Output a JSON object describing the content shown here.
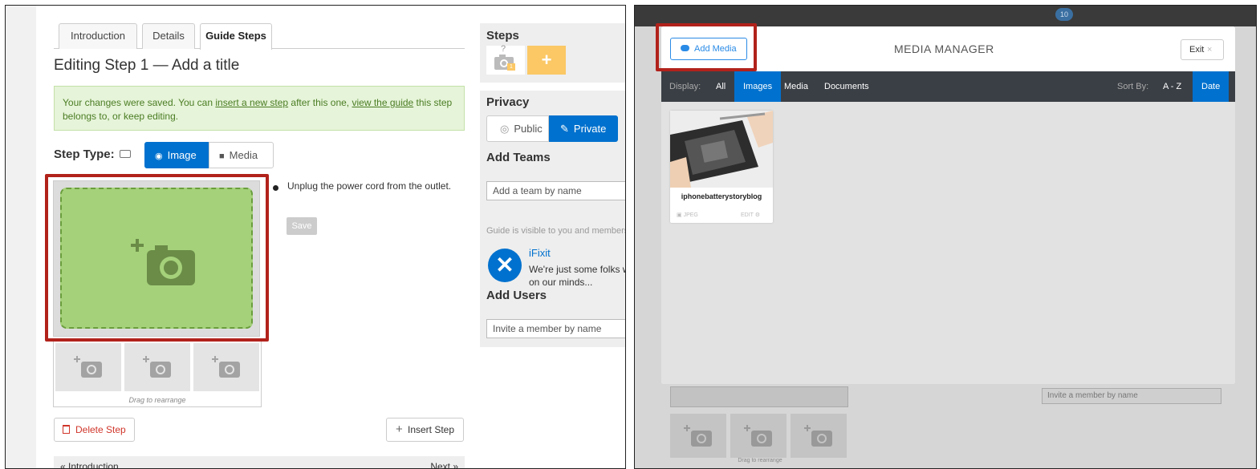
{
  "left": {
    "tabs": [
      "Introduction",
      "Details",
      "Guide Steps"
    ],
    "editing_title": "Editing Step 1 — Add a title",
    "notice": {
      "prefix": "Your changes were saved. You can ",
      "link1": "insert a new step",
      "mid": " after this one, ",
      "link2": "view the guide",
      "suffix": " this step belongs to, or keep editing."
    },
    "step_type_label": "Step Type:",
    "step_type_options": [
      "Image",
      "Media"
    ],
    "bullet_text": "Unplug the power cord from the outlet.",
    "save_label": "Save",
    "drag_text": "Drag to rearrange",
    "delete_label": "Delete Step",
    "insert_label": "Insert Step",
    "pager_prev": "« Introduction",
    "pager_next": "Next »"
  },
  "sidebar": {
    "steps_heading": "Steps",
    "step_badge": "1",
    "step_question": "?",
    "add_step_glyph": "+",
    "privacy_heading": "Privacy",
    "public_label": "Public",
    "private_label": "Private",
    "add_teams_heading": "Add Teams",
    "team_input_placeholder": "Add a team by name",
    "visible_note": "Guide is visible to you and members",
    "team_name": "iFixit",
    "team_desc_1": "We're just some folks w",
    "team_desc_2": "on our minds...",
    "add_users_heading": "Add Users",
    "user_input_placeholder": "Invite a member by name"
  },
  "media_manager": {
    "notification_count": "10",
    "add_media_label": "Add Media",
    "title": "MEDIA MANAGER",
    "exit_label": "Exit",
    "display_label": "Display:",
    "filters": [
      "All",
      "Images",
      "Media",
      "Documents"
    ],
    "active_filter": "Images",
    "sort_label": "Sort By:",
    "sort_options": [
      "A - Z",
      "Date"
    ],
    "active_sort": "Date",
    "item": {
      "name": "iphonebatterystoryblog",
      "type": "JPEG",
      "edit": "EDIT"
    },
    "background_input": "Invite a member by name",
    "background_drag_text": "Drag to rearrange"
  },
  "colors": {
    "accent": "#0071ce",
    "highlight": "#b1221b",
    "drop_zone": "#a5d17a",
    "notice_bg": "#e6f4d9",
    "add_step": "#fbc865"
  }
}
